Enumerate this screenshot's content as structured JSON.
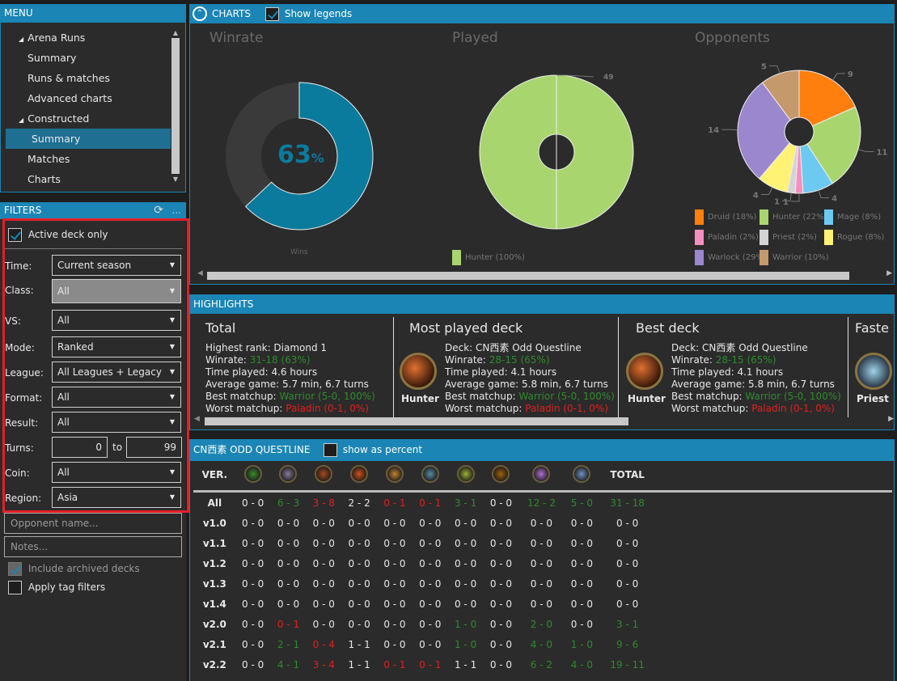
{
  "menu": {
    "title": "MENU",
    "items": [
      {
        "label": "Arena Runs",
        "group": true
      },
      {
        "label": "Summary"
      },
      {
        "label": "Runs & matches"
      },
      {
        "label": "Advanced charts"
      },
      {
        "label": "Constructed",
        "group": true
      },
      {
        "label": "Summary",
        "selected": true
      },
      {
        "label": "Matches"
      },
      {
        "label": "Charts"
      }
    ]
  },
  "filters": {
    "title": "FILTERS",
    "refresh_icon": "refresh-icon",
    "more_label": "...",
    "active_deck_only": {
      "label": "Active deck only",
      "checked": true
    },
    "time": {
      "label": "Time:",
      "value": "Current season"
    },
    "class": {
      "label": "Class:",
      "value": "All"
    },
    "vs": {
      "label": "VS:",
      "value": "All"
    },
    "mode": {
      "label": "Mode:",
      "value": "Ranked"
    },
    "league": {
      "label": "League:",
      "value": "All Leagues + Legacy"
    },
    "format": {
      "label": "Format:",
      "value": "All"
    },
    "result": {
      "label": "Result:",
      "value": "All"
    },
    "turns": {
      "label": "Turns:",
      "from": "0",
      "to_label": "to",
      "to": "99"
    },
    "coin": {
      "label": "Coin:",
      "value": "All"
    },
    "region": {
      "label": "Region:",
      "value": "Asia"
    },
    "opponent_placeholder": "Opponent name...",
    "notes_placeholder": "Notes...",
    "include_archived": {
      "label": "Include archived decks",
      "checked": true
    },
    "apply_tag": {
      "label": "Apply tag filters",
      "checked": false
    },
    "highlight_color": "#e21f26"
  },
  "charts": {
    "title": "CHARTS",
    "show_legends": {
      "label": "Show legends",
      "checked": true
    },
    "winrate": {
      "title": "Winrate",
      "percent": "63",
      "unit": "%",
      "wins_fraction": 0.63,
      "legend": "Wins",
      "color": "#0a7b9c",
      "rest_color": "#3a3a3a"
    },
    "played": {
      "title": "Played",
      "label": "49",
      "legend": "Hunter (100%)",
      "color": "#a9d56f"
    },
    "opponents": {
      "title": "Opponents",
      "slices": [
        {
          "name": "Druid",
          "value": 9,
          "legend": "Druid (18%)",
          "color": "#ff7f0e"
        },
        {
          "name": "Hunter",
          "value": 11,
          "legend": "Hunter (22%)",
          "color": "#a9d56f"
        },
        {
          "name": "Mage",
          "value": 4,
          "legend": "Mage (8%)",
          "color": "#6ccaf0"
        },
        {
          "name": "Paladin",
          "value": 1,
          "legend": "Paladin (2%)",
          "color": "#f48fbf"
        },
        {
          "name": "Priest",
          "value": 1,
          "legend": "Priest (2%)",
          "color": "#d4d4d4"
        },
        {
          "name": "Rogue",
          "value": 4,
          "legend": "Rogue (8%)",
          "color": "#fff275"
        },
        {
          "name": "Warlock",
          "value": 14,
          "legend": "Warlock (29%)",
          "color": "#9a87cd"
        },
        {
          "name": "Warrior",
          "value": 5,
          "legend": "Warrior (10%)",
          "color": "#c49a6c"
        }
      ]
    }
  },
  "highlights": {
    "title": "HIGHLIGHTS",
    "cards": [
      {
        "title": "Total",
        "lines": [
          [
            "Highest rank: Diamond 1",
            ""
          ],
          [
            "Winrate: ",
            "31-18 (63%)",
            "g"
          ],
          [
            "Time played: 4.6 hours",
            ""
          ],
          [
            "Average game: 5.7 min, 6.7 turns",
            ""
          ],
          [
            "Best matchup: ",
            "Warrior (5-0, 100%)",
            "g"
          ],
          [
            "Worst matchup: ",
            "Paladin (0-1, 0%)",
            "r"
          ]
        ]
      },
      {
        "title": "Most played deck",
        "class": "Hunter",
        "lines": [
          [
            "Deck: CN西素 Odd Questline",
            ""
          ],
          [
            "Winrate: ",
            "28-15 (65%)",
            "g"
          ],
          [
            "Time played: 4.1 hours",
            ""
          ],
          [
            "Average game: 5.8 min, 6.7 turns",
            ""
          ],
          [
            "Best matchup: ",
            "Warrior (5-0, 100%)",
            "g"
          ],
          [
            "Worst matchup: ",
            "Paladin (0-1, 0%)",
            "r"
          ]
        ]
      },
      {
        "title": "Best deck",
        "class": "Hunter",
        "lines": [
          [
            "Deck: CN西素 Odd Questline",
            ""
          ],
          [
            "Winrate: ",
            "28-15 (65%)",
            "g"
          ],
          [
            "Time played: 4.1 hours",
            ""
          ],
          [
            "Average game: 5.8 min, 6.7 turns",
            ""
          ],
          [
            "Best matchup: ",
            "Warrior (5-0, 100%)",
            "g"
          ],
          [
            "Worst matchup: ",
            "Paladin (0-1, 0%)",
            "r"
          ]
        ]
      },
      {
        "title": "Faste",
        "class": "Priest",
        "lines": []
      }
    ]
  },
  "deck_table": {
    "title": "CN西素 ODD QUESTLINE",
    "show_percent": {
      "label": "show as percent",
      "checked": false
    },
    "ver_header": "VER.",
    "total_header": "TOTAL",
    "class_icons": [
      "druid",
      "hunter",
      "hunter",
      "mage",
      "paladin",
      "priest",
      "rogue",
      "shaman",
      "warlock",
      "warrior"
    ],
    "icon_colors": [
      "#3a8a2a",
      "#8a7a9a",
      "#a84a1a",
      "#d0501a",
      "#c08030",
      "#5a8aa0",
      "#9ab030",
      "#a06010",
      "#b070d0",
      "#7090c0"
    ],
    "rows": [
      [
        "All",
        "0 - 0",
        "6 - 3",
        "3 - 8",
        "2 - 2",
        "0 - 1",
        "0 - 1",
        "3 - 1",
        "0 - 0",
        "12 - 2",
        "5 - 0",
        "31 - 18"
      ],
      [
        "v1.0",
        "0 - 0",
        "0 - 0",
        "0 - 0",
        "0 - 0",
        "0 - 0",
        "0 - 0",
        "0 - 0",
        "0 - 0",
        "0 - 0",
        "0 - 0",
        "0 - 0"
      ],
      [
        "v1.1",
        "0 - 0",
        "0 - 0",
        "0 - 0",
        "0 - 0",
        "0 - 0",
        "0 - 0",
        "0 - 0",
        "0 - 0",
        "0 - 0",
        "0 - 0",
        "0 - 0"
      ],
      [
        "v1.2",
        "0 - 0",
        "0 - 0",
        "0 - 0",
        "0 - 0",
        "0 - 0",
        "0 - 0",
        "0 - 0",
        "0 - 0",
        "0 - 0",
        "0 - 0",
        "0 - 0"
      ],
      [
        "v1.3",
        "0 - 0",
        "0 - 0",
        "0 - 0",
        "0 - 0",
        "0 - 0",
        "0 - 0",
        "0 - 0",
        "0 - 0",
        "0 - 0",
        "0 - 0",
        "0 - 0"
      ],
      [
        "v1.4",
        "0 - 0",
        "0 - 0",
        "0 - 0",
        "0 - 0",
        "0 - 0",
        "0 - 0",
        "0 - 0",
        "0 - 0",
        "0 - 0",
        "0 - 0",
        "0 - 0"
      ],
      [
        "v2.0",
        "0 - 0",
        "0 - 1",
        "0 - 0",
        "0 - 0",
        "0 - 0",
        "0 - 0",
        "1 - 0",
        "0 - 0",
        "2 - 0",
        "0 - 0",
        "3 - 1"
      ],
      [
        "v2.1",
        "0 - 0",
        "2 - 1",
        "0 - 4",
        "1 - 1",
        "0 - 0",
        "0 - 0",
        "1 - 0",
        "0 - 0",
        "4 - 0",
        "1 - 0",
        "9 - 6"
      ],
      [
        "v2.2",
        "0 - 0",
        "4 - 1",
        "3 - 4",
        "1 - 1",
        "0 - 1",
        "0 - 1",
        "1 - 1",
        "0 - 0",
        "6 - 2",
        "4 - 0",
        "19 - 11"
      ]
    ]
  }
}
